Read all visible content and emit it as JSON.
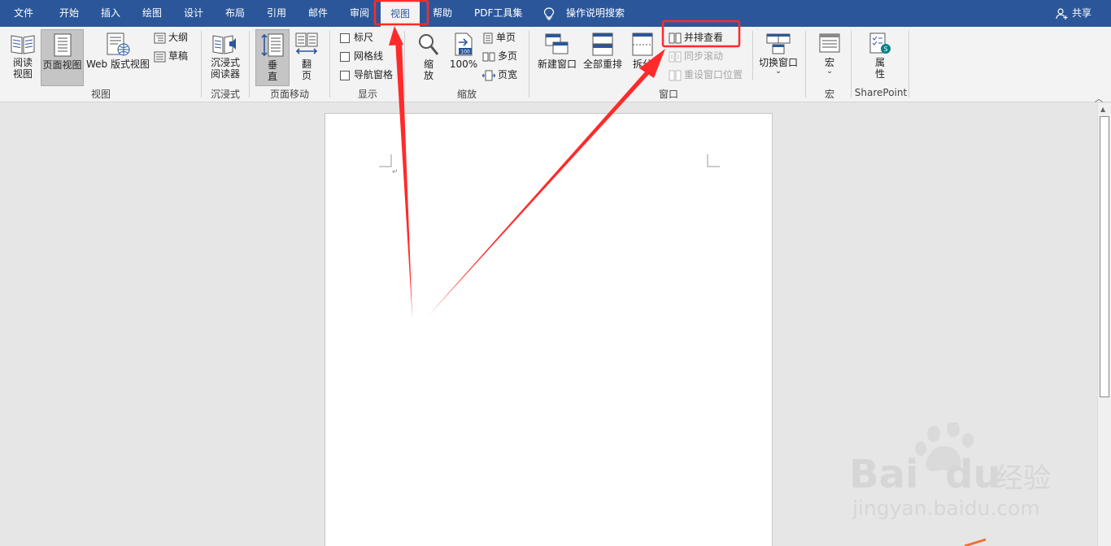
{
  "tabs": [
    {
      "label": "文件"
    },
    {
      "label": "开始"
    },
    {
      "label": "插入"
    },
    {
      "label": "绘图"
    },
    {
      "label": "设计"
    },
    {
      "label": "布局"
    },
    {
      "label": "引用"
    },
    {
      "label": "邮件"
    },
    {
      "label": "审阅"
    },
    {
      "label": "视图",
      "active": true
    },
    {
      "label": "帮助"
    },
    {
      "label": "PDF工具集"
    }
  ],
  "tellme": {
    "label": "操作说明搜索",
    "icon": "lightbulb-icon"
  },
  "share": {
    "label": "共享",
    "icon": "person-add-icon"
  },
  "ribbon": {
    "views": {
      "group_label": "视图",
      "read_mode": {
        "line1": "阅读",
        "line2": "视图"
      },
      "print_layout": {
        "label": "页面视图"
      },
      "web_layout": {
        "label": "Web 版式视图"
      },
      "outline": {
        "label": "大纲"
      },
      "draft": {
        "label": "草稿"
      }
    },
    "immersive": {
      "group_label": "沉浸式",
      "reader": {
        "line1": "沉浸式",
        "line2": "阅读器"
      }
    },
    "page_movement": {
      "group_label": "页面移动",
      "vertical": {
        "line1": "垂",
        "line2": "直"
      },
      "side_to_side": {
        "line1": "翻",
        "line2": "页"
      }
    },
    "show": {
      "group_label": "显示",
      "ruler": {
        "label": "标尺",
        "checked": false
      },
      "gridlines": {
        "label": "网格线",
        "checked": false
      },
      "nav_pane": {
        "label": "导航窗格",
        "checked": false
      }
    },
    "zoom": {
      "group_label": "缩放",
      "zoom": {
        "line1": "缩",
        "line2": "放"
      },
      "hundred": {
        "label": "100%",
        "icon_text": "100"
      },
      "one_page": {
        "label": "单页"
      },
      "multi_page": {
        "label": "多页"
      },
      "page_width": {
        "label": "页宽"
      }
    },
    "window": {
      "group_label": "窗口",
      "new_window": {
        "label": "新建窗口"
      },
      "arrange_all": {
        "label": "全部重排"
      },
      "split": {
        "label": "拆分"
      },
      "side_by_side": {
        "label": "并排查看"
      },
      "sync_scroll": {
        "label": "同步滚动",
        "disabled": true
      },
      "reset_position": {
        "label": "重设窗口位置",
        "disabled": true
      },
      "switch_windows": {
        "label": "切换窗口"
      }
    },
    "macros": {
      "group_label": "宏",
      "macros_btn": {
        "label": "宏"
      }
    },
    "sharepoint": {
      "group_label": "SharePoint",
      "properties": {
        "line1": "属",
        "line2": "性"
      }
    }
  },
  "document": {
    "paragraph_mark": "↵"
  },
  "watermark": {
    "brand": "Bai",
    "brand2": "du",
    "suffix": "经验",
    "url": "jingyan.baidu.com"
  },
  "colors": {
    "tab_bar": "#2b579a",
    "ribbon_bg": "#f3f3f3",
    "annotation_red": "#ff2a2a",
    "doc_bg": "#e6e6e6"
  }
}
